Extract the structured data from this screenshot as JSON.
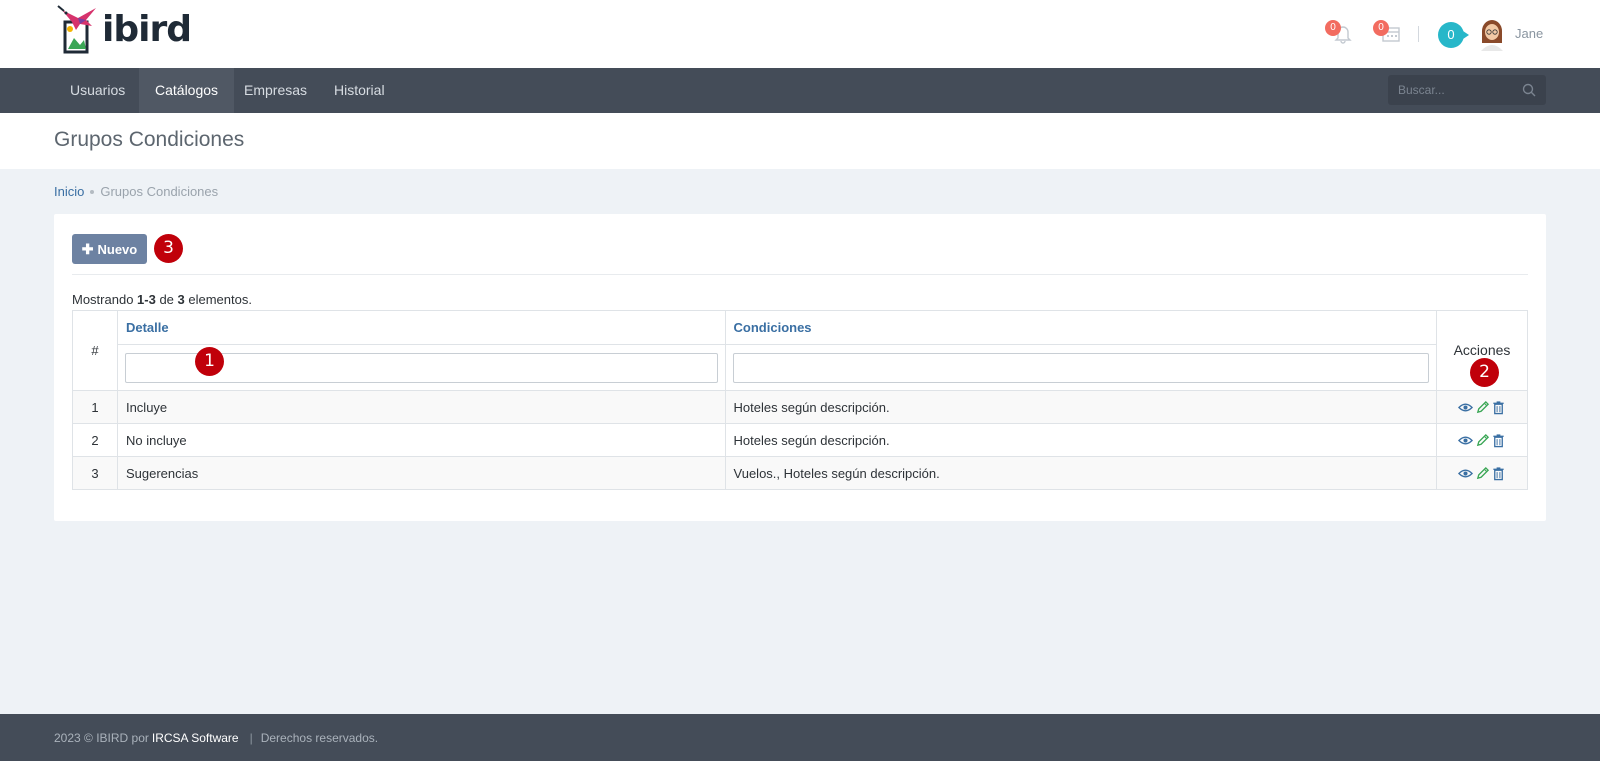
{
  "header": {
    "logo_text": "ibird",
    "notifications_count": "0",
    "calendar_count": "0",
    "messages_count": "0",
    "user_name": "Jane"
  },
  "nav": {
    "items": [
      {
        "label": "Usuarios"
      },
      {
        "label": "Catálogos"
      },
      {
        "label": "Empresas"
      },
      {
        "label": "Historial"
      }
    ],
    "active": "Catálogos",
    "search_placeholder": "Buscar..."
  },
  "page": {
    "title": "Grupos Condiciones",
    "breadcrumb": {
      "home": "Inicio",
      "current": "Grupos Condiciones"
    }
  },
  "toolbar": {
    "new_label": "Nuevo"
  },
  "summary": {
    "prefix": "Mostrando ",
    "range": "1-3",
    "middle": " de ",
    "total": "3",
    "suffix": " elementos."
  },
  "table": {
    "headers": {
      "num": "#",
      "detalle": "Detalle",
      "condiciones": "Condiciones",
      "acciones": "Acciones"
    },
    "filters": {
      "detalle": "",
      "condiciones": ""
    },
    "rows": [
      {
        "num": "1",
        "detalle": "Incluye",
        "condiciones": "Hoteles según descripción."
      },
      {
        "num": "2",
        "detalle": "No incluye",
        "condiciones": "Hoteles según descripción."
      },
      {
        "num": "3",
        "detalle": "Sugerencias",
        "condiciones": "Vuelos., Hoteles según descripción."
      }
    ]
  },
  "annotations": {
    "one": "1",
    "two": "2",
    "three": "3"
  },
  "footer": {
    "copyright": "2023 © IBIRD por",
    "company": "IRCSA Software",
    "separator": "|",
    "rights": "Derechos reservados."
  },
  "colors": {
    "nav_bg": "#444c58",
    "primary_link": "#3a6fa3",
    "button": "#6d82a2",
    "badge": "#f26c60",
    "annotation": "#c0000a",
    "messages": "#27b7c9"
  }
}
